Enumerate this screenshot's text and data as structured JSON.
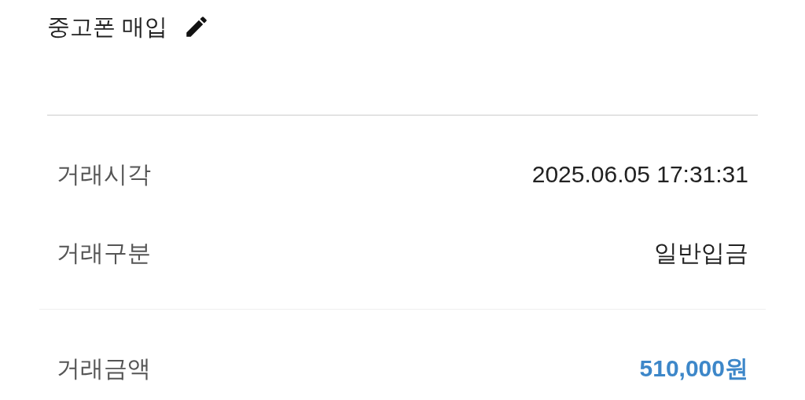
{
  "title": "중고폰 매입",
  "sections": [
    {
      "rows": [
        {
          "label": "거래시각",
          "value": "2025.06.05 17:31:31",
          "kind": "plain"
        },
        {
          "label": "거래구분",
          "value": "일반입금",
          "kind": "plain"
        }
      ]
    },
    {
      "rows": [
        {
          "label": "거래금액",
          "value": "510,000원",
          "kind": "amount"
        }
      ]
    }
  ]
}
